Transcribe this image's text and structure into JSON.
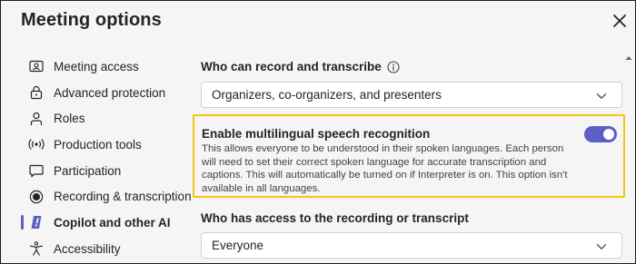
{
  "dialog": {
    "title": "Meeting options"
  },
  "nav": {
    "items": [
      {
        "label": "Meeting access",
        "icon": "id-card-icon"
      },
      {
        "label": "Advanced protection",
        "icon": "lock-icon"
      },
      {
        "label": "Roles",
        "icon": "person-icon"
      },
      {
        "label": "Production tools",
        "icon": "broadcast-icon"
      },
      {
        "label": "Participation",
        "icon": "chat-icon"
      },
      {
        "label": "Recording & transcription",
        "icon": "record-icon"
      },
      {
        "label": "Copilot and other AI",
        "icon": "copilot-icon",
        "active": true
      },
      {
        "label": "Accessibility",
        "icon": "accessibility-icon"
      }
    ]
  },
  "main": {
    "record_label": "Who can record and transcribe",
    "record_value": "Organizers, co-organizers, and presenters",
    "multilingual": {
      "title": "Enable multilingual speech recognition",
      "description": "This allows everyone to be understood in their spoken languages. Each person will need to set their correct spoken language for accurate transcription and captions. This will automatically be turned on if Interpreter is on. This option isn't available in all languages.",
      "enabled": true
    },
    "access_label": "Who has access to the recording or transcript",
    "access_value": "Everyone"
  },
  "colors": {
    "accent": "#5b5fc7",
    "highlight_border": "#f2c811",
    "background": "#f5f5f5"
  }
}
